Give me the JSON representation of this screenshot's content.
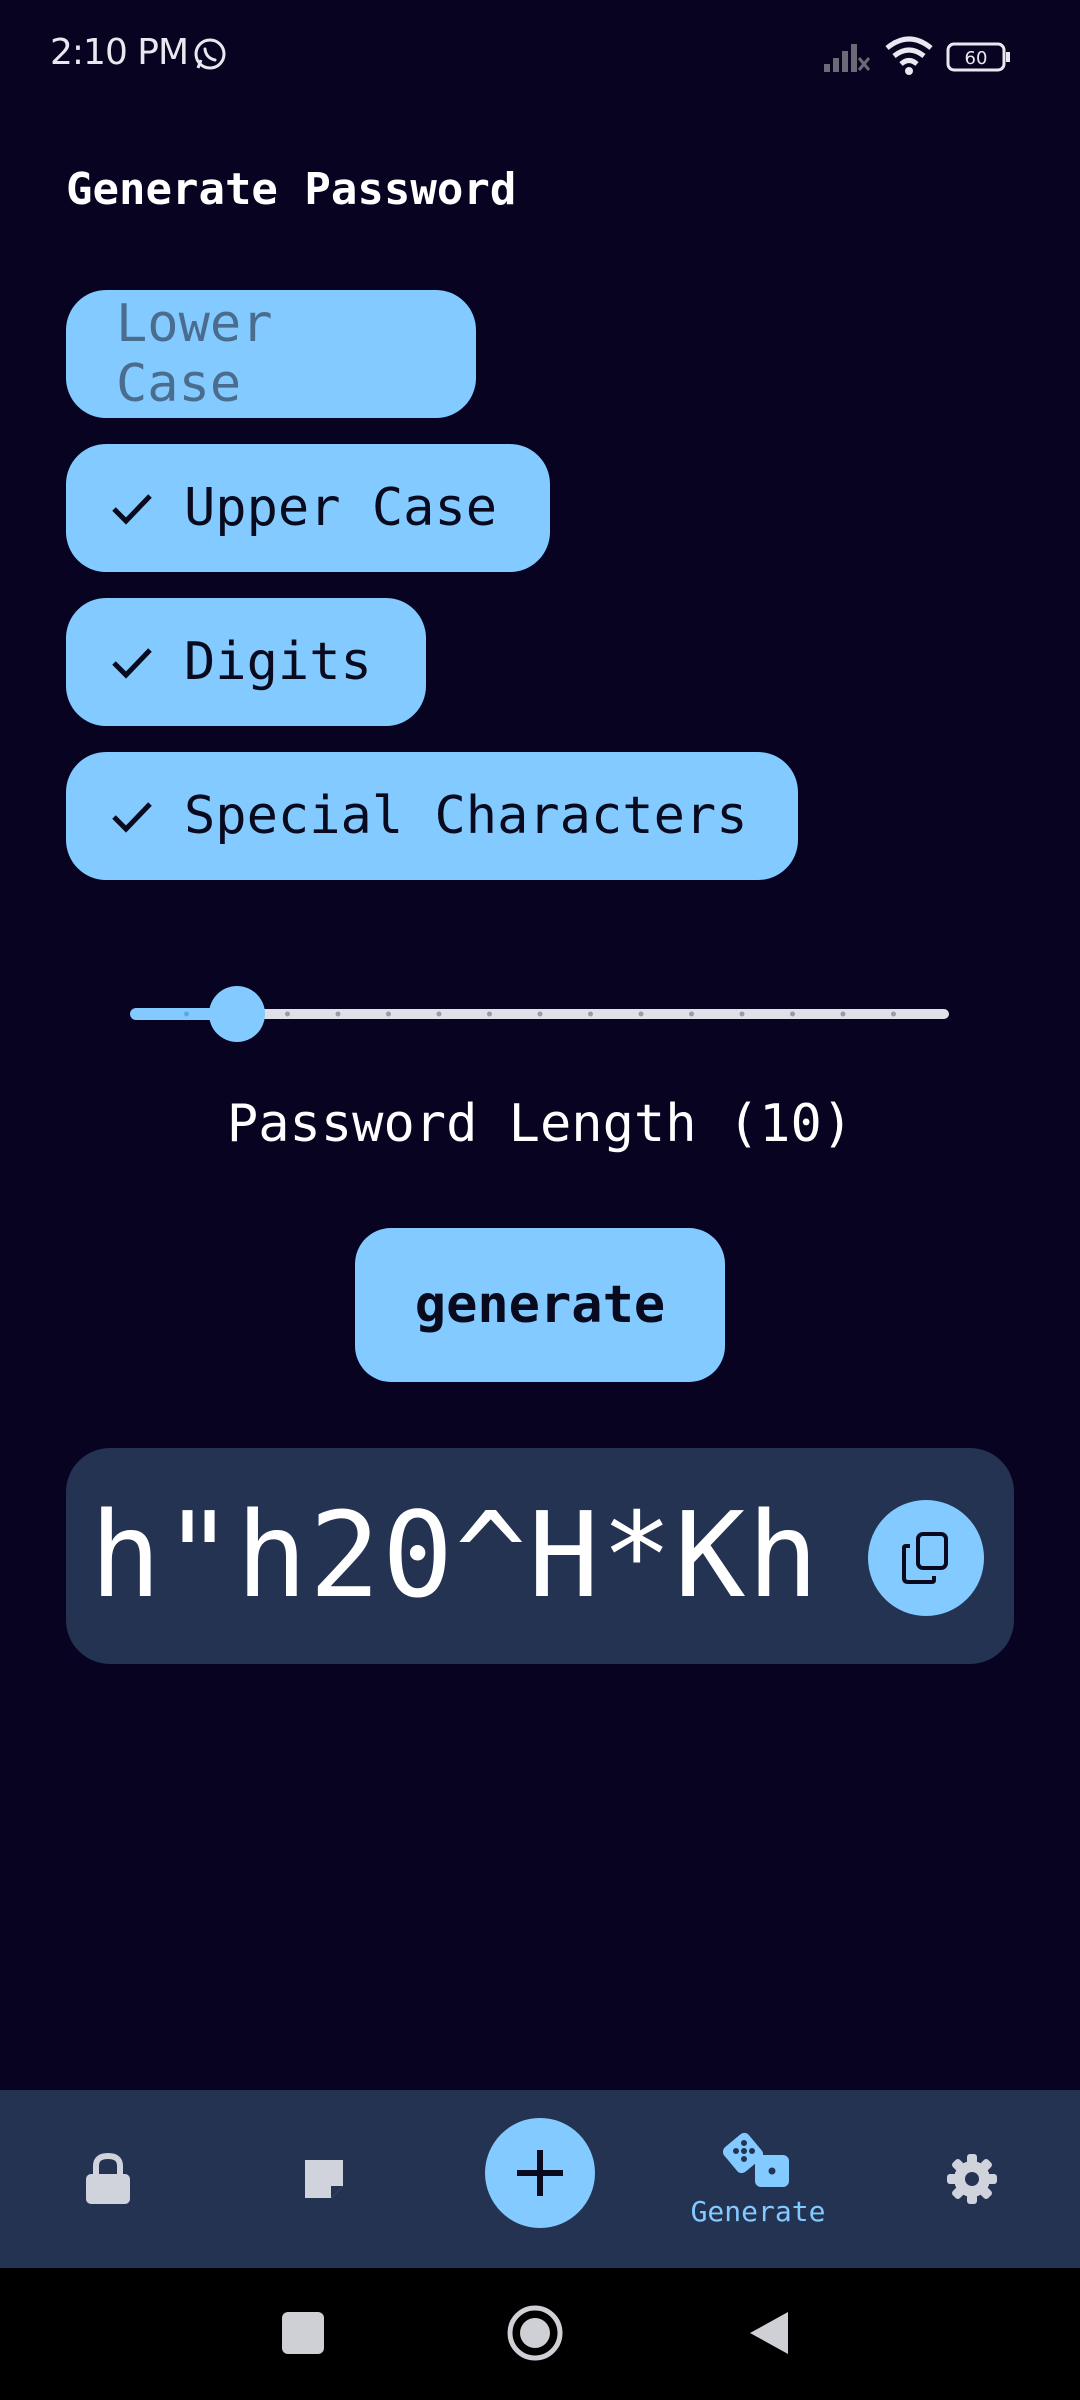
{
  "status_bar": {
    "time": "2:10 PM",
    "battery": "60"
  },
  "page": {
    "title": "Generate Password"
  },
  "options": [
    {
      "label": "Lower Case",
      "checked": false
    },
    {
      "label": "Upper Case",
      "checked": true
    },
    {
      "label": "Digits",
      "checked": true
    },
    {
      "label": "Special Characters",
      "checked": true
    }
  ],
  "slider": {
    "min": 8,
    "max": 24,
    "value": 10
  },
  "length_label": "Password Length (10)",
  "generate_button": {
    "label": "generate"
  },
  "password": {
    "value": "h\"h20^H*Kh"
  },
  "bottom_nav": {
    "items": [
      {
        "icon": "lock-icon"
      },
      {
        "icon": "note-icon"
      },
      {
        "icon": "plus-icon"
      },
      {
        "icon": "dice-icon",
        "label": "Generate",
        "active": true
      },
      {
        "icon": "gear-icon"
      }
    ]
  },
  "colors": {
    "background": "#070321",
    "accent": "#82caff",
    "card": "#243352"
  }
}
